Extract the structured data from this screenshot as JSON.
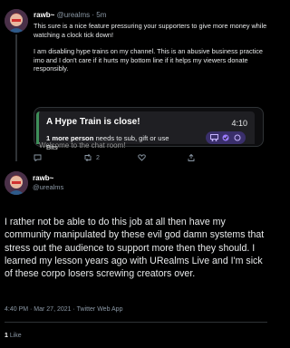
{
  "tweet1": {
    "name": "rawb~",
    "handle": "@urealms",
    "time": "· 5m",
    "paragraph1": "This sure is a nice feature pressuring your supporters to give more money while watching a clock tick down!",
    "paragraph2": "I am disabling hype trains on my channel. This is an abusive business practice imo and I don't care if it hurts my bottom line if it helps my viewers donate responsibly.",
    "replies": "",
    "retweets": "2",
    "likes": ""
  },
  "embed": {
    "title": "A Hype Train is close!",
    "timer": "4:10",
    "subtitle_bold": "1 more person",
    "subtitle_rest": " needs to sub, gift or use Bits",
    "chat_text": "Welcome to the chat room!",
    "badge_color": "#3a2f6b",
    "accent_color": "#3f8f5a"
  },
  "tweet2": {
    "name": "rawb~",
    "handle": "@urealms",
    "text": "I rather not be able to do this job at all then have my community manipulated by these evil god damn systems that stress out the audience to support more then they should. I learned my lesson years ago with URealms Live and I'm sick of these corpo losers screwing creators over.",
    "meta": "4:40 PM · Mar 27, 2021 · Twitter Web App",
    "like_count": "1",
    "like_label": "Like"
  }
}
